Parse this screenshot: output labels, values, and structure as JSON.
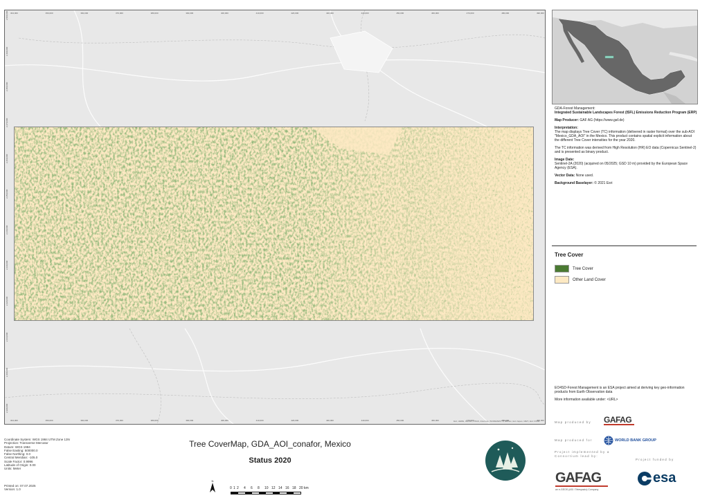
{
  "map": {
    "top_ticks": [
      "304,000",
      "350,000",
      "360,000",
      "370,000",
      "380,000",
      "390,000",
      "400,000",
      "410,000",
      "420,000",
      "430,000",
      "440,000",
      "450,000",
      "460,000",
      "470,000",
      "480,000",
      "490,000"
    ],
    "left_ticks": [
      "2,500,000",
      "2,490,000",
      "2,480,000",
      "2,470,000",
      "2,460,000",
      "2,450,000",
      "2,440,000",
      "2,430,000",
      "2,420,000",
      "2,410,000",
      "2,400,000",
      "2,390,000"
    ],
    "attribution": "Esri, HERE, Garmin, USGS, Intermap, INCREMENT P, NRCan, Esri Japan, METI, Esri China"
  },
  "info": {
    "program_label": "GDA-Forest Management:",
    "program_name": "Integrated Sustainable Landscapes Forest (ISFL) Emissions Reduction Program (ERP)",
    "producer_label": "Map Producer:",
    "producer_value": "GAF AG (https://www.gaf.de)",
    "interpretation_label": "Interpretation:",
    "interpretation_text": "The map displays Tree Cover (TC) information (delivered in raster format) over the sub-AOI \"Mexico_GDA_AOI\" in the Mexico. This product contains spatial explicit information about the different Tree Cover intensities for the year 2020.",
    "interpretation_text2": "The TC information was derived from High Resolution (HR) EO data (Copernicus Sentinel-2) and is presented as binary product.",
    "image_date_label": "Image Date:",
    "image_date_text": "Sentinel-2A (2020) (acquired on 05/2025; GSD 10 m) provided by the European Space Agency (ESA).",
    "vector_label": "Vector Data:",
    "vector_value": "None used.",
    "baselayer_label": "Background Baselayer:",
    "baselayer_value": "© 2021 Esri"
  },
  "legend": {
    "title": "Tree Cover",
    "items": [
      {
        "label": "Tree Cover",
        "color": "#4a7a32"
      },
      {
        "label": "Other Land Cover",
        "color": "#fde9c3"
      }
    ]
  },
  "footer_right": {
    "eo4sd_text": "EO4SD-Forest Management is an ESA project aimed at deriving key geo-information products from Earth Observation data",
    "more_info": "More information available under: <URL>",
    "produced_by": "Map produced by",
    "produced_for": "Map produced for",
    "implemented_by": "Project implemented by a Consortium lead by:",
    "funded_by": "Project funded by",
    "gaf_logo": "GAFAG",
    "worldbank_logo": "WORLD BANK GROUP",
    "gaf_big_logo": "GAFAG",
    "gaf_tagline": "an e-GEOS (ASI / Telespazio) Company",
    "esa_logo": "esa"
  },
  "footer_left": {
    "crs_lines": [
      "Coordinate System: WGS 1984 UTM Zone 13N",
      "Projection: Transverse Mercator",
      "Datum: WGS 1984",
      "False Easting: 500000.0",
      "False Northing: 0.0",
      "Central Meridian: -105.0",
      "Scale Factor: 0.9996",
      "Latitude of Origin: 0.00",
      "Units: Meter"
    ],
    "printed_lines": [
      "Printed on: 07.07.2025",
      "Version: 1.0"
    ]
  },
  "title": {
    "main": "Tree CoverMap, GDA_AOI_conafor, Mexico",
    "sub": "Status 2020"
  },
  "scalebar": {
    "north": "N",
    "labels": [
      "0",
      "1",
      "2",
      "4",
      "6",
      "8",
      "10",
      "12",
      "14",
      "16",
      "18",
      "20 km"
    ]
  }
}
